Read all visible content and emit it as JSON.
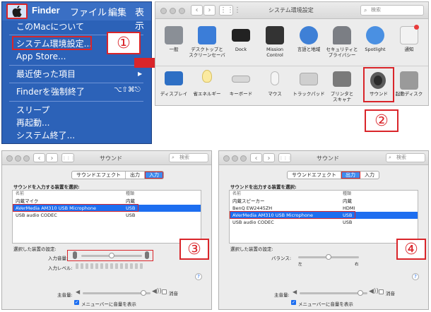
{
  "menu": {
    "apple_icon": "apple-logo",
    "menubar": [
      "Finder",
      "ファイル",
      "編集",
      "表示"
    ],
    "items": [
      {
        "label": "このMacについて"
      },
      {
        "label": "システム環境設定..."
      },
      {
        "label": "App Store..."
      },
      {
        "label": "最近使った項目"
      },
      {
        "label": "Finderを強制終了",
        "shortcut": "⌥⇧⌘⎋"
      },
      {
        "label": "スリープ"
      },
      {
        "label": "再起動..."
      },
      {
        "label": "システム終了..."
      }
    ],
    "badge": "①"
  },
  "syspref": {
    "title": "システム環境設定",
    "search_placeholder": "検索",
    "row1": [
      {
        "label": "一般",
        "icon": "general-icon"
      },
      {
        "label": "デスクトップと\nスクリーンセーバ",
        "icon": "desktop-icon"
      },
      {
        "label": "Dock",
        "icon": "dock-icon"
      },
      {
        "label": "Mission\nControl",
        "icon": "mission-control-icon"
      },
      {
        "label": "言語と地域",
        "icon": "language-icon"
      },
      {
        "label": "セキュリティと\nプライバシー",
        "icon": "security-icon"
      },
      {
        "label": "Spotlight",
        "icon": "spotlight-icon"
      },
      {
        "label": "通知",
        "icon": "notifications-icon"
      }
    ],
    "row2": [
      {
        "label": "ディスプレイ",
        "icon": "display-icon"
      },
      {
        "label": "省エネルギー",
        "icon": "energy-icon"
      },
      {
        "label": "キーボード",
        "icon": "keyboard-icon"
      },
      {
        "label": "マウス",
        "icon": "mouse-icon"
      },
      {
        "label": "トラックパッド",
        "icon": "trackpad-icon"
      },
      {
        "label": "プリンタと\nスキャナ",
        "icon": "printer-icon"
      },
      {
        "label": "サウンド",
        "icon": "sound-icon"
      },
      {
        "label": "起動ディスク",
        "icon": "startup-disk-icon"
      }
    ],
    "badge": "②"
  },
  "sound_input": {
    "title": "サウンド",
    "search_placeholder": "検索",
    "tabs": [
      "サウンドエフェクト",
      "出力",
      "入力"
    ],
    "active_tab": "入力",
    "select_label": "サウンドを入力する装置を選択:",
    "col_name": "名前",
    "col_type": "種類",
    "devices": [
      {
        "name": "内蔵マイク",
        "type": "内蔵"
      },
      {
        "name": "AVerMedia AM310 USB Microphone",
        "type": "USB"
      },
      {
        "name": "USB audio CODEC",
        "type": "USB"
      }
    ],
    "selected_settings_label": "選択した装置の設定:",
    "input_volume_label": "入力音量:",
    "input_level_label": "入力レベル:",
    "input_volume": 0.5,
    "output_volume_label": "主音量:",
    "mute_label": "消音",
    "menubar_label": "メニューバーに音量を表示",
    "help": "?",
    "badge": "③"
  },
  "sound_output": {
    "title": "サウンド",
    "search_placeholder": "検索",
    "tabs": [
      "サウンドエフェクト",
      "出力",
      "入力"
    ],
    "active_tab": "出力",
    "select_label": "サウンドを出力する装置を選択:",
    "col_name": "名前",
    "col_type": "種類",
    "devices": [
      {
        "name": "内蔵スピーカー",
        "type": "内蔵"
      },
      {
        "name": "BenQ EW2445ZH",
        "type": "HDMI"
      },
      {
        "name": "AVerMedia AM310 USB Microphone",
        "type": "USB"
      },
      {
        "name": "USB audio CODEC",
        "type": "USB"
      }
    ],
    "selected_settings_label": "選択した装置の設定:",
    "balance_label": "バランス:",
    "balance_left": "左",
    "balance_right": "右",
    "balance": 0.5,
    "output_volume_label": "主音量:",
    "mute_label": "消音",
    "menubar_label": "メニューバーに音量を表示",
    "help": "?",
    "badge": "④"
  },
  "colors": {
    "highlight": "#d9252a",
    "menu_bg": "#2c62b8",
    "selection": "#1d6ef0"
  }
}
